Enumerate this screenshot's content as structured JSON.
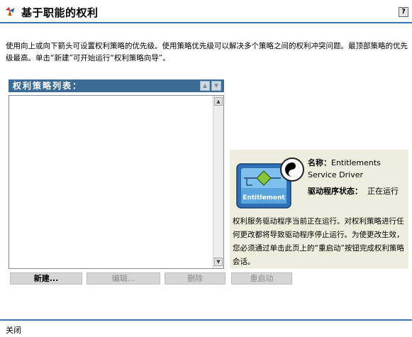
{
  "header": {
    "title": "基于职能的权利",
    "help_label": "?"
  },
  "description": "使用向上或向下箭头可设置权利策略的优先级。使用策略优先级可以解决多个策略之间的权利冲突问题。最顶部策略的优先级最高。单击“新建”可开始运行“权利策略向导”。",
  "policy_list": {
    "header": "权利策略列表：",
    "items": []
  },
  "driver_info": {
    "icon_text": "Entitlement",
    "name_label": "名称：",
    "name_value": "Entitlements Service Driver",
    "status_label": "驱动程序状态：",
    "status_value": "正在运行",
    "message": "权利服务驱动程序当前正在运行。对权利策略进行任何更改都将导致驱动程序停止运行。为使更改生效，您必须通过单击此页上的“重启动”按钮完成权利策略会话。"
  },
  "buttons": {
    "new": "新建...",
    "edit": "编辑...",
    "delete": "删除",
    "restart": "重启动"
  },
  "footer": {
    "close": "关闭"
  },
  "colors": {
    "accent": "#3a77b0",
    "list_header": "#3c6c96",
    "info_panel": "#eeeede"
  }
}
